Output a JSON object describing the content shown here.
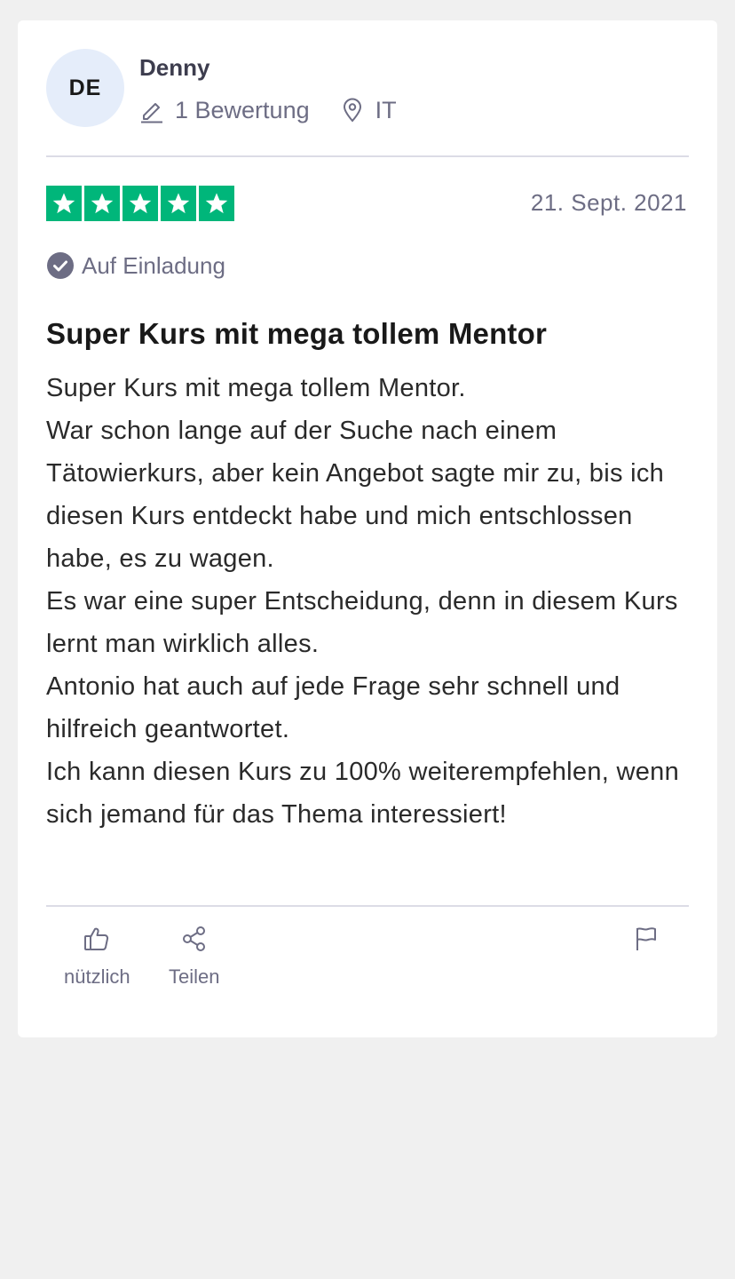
{
  "review": {
    "author": {
      "initials": "DE",
      "name": "Denny",
      "review_count": "1 Bewertung",
      "country": "IT"
    },
    "rating": 5,
    "rating_color": "#00b67a",
    "date": "21. Sept. 2021",
    "verification": "Auf Einladung",
    "title": "Super Kurs mit mega tollem Mentor",
    "body": [
      "Super Kurs mit mega tollem Mentor.",
      "War schon lange auf der Suche nach einem Tätowierkurs, aber kein Angebot sagte mir zu, bis ich diesen Kurs entdeckt habe und mich entschlossen habe, es zu wagen.",
      "Es war eine super Entscheidung, denn in diesem Kurs lernt man wirklich alles.",
      "Antonio hat auch auf jede Frage sehr schnell und hilfreich geantwortet.",
      "Ich kann diesen Kurs zu 100% weiterempfehlen, wenn sich jemand für das Thema interessiert!"
    ],
    "actions": {
      "useful_label": "nützlich",
      "share_label": "Teilen",
      "flag_icon": "flag-icon"
    }
  }
}
